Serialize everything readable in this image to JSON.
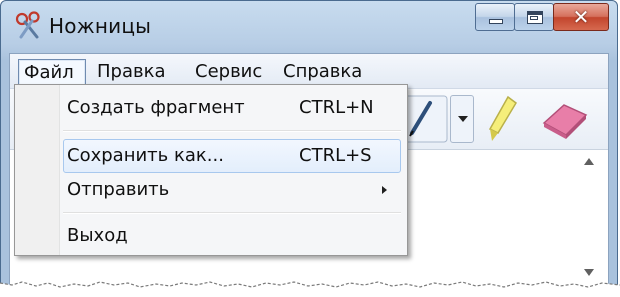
{
  "window": {
    "title": "Ножницы",
    "app_icon": "scissors-icon",
    "buttons": {
      "minimize_icon": "minimize-icon",
      "maximize_icon": "maximize-icon",
      "close_icon": "close-icon",
      "close_glyph": "✕"
    }
  },
  "menubar": {
    "items": [
      {
        "label": "Файл",
        "open": true
      },
      {
        "label": "Правка"
      },
      {
        "label": "Сервис"
      },
      {
        "label": "Справка"
      }
    ]
  },
  "toolbar": {
    "tools": [
      "pen-icon",
      "dropdown-arrow-icon",
      "highlighter-icon",
      "eraser-icon"
    ]
  },
  "file_menu": {
    "items": [
      {
        "label": "Создать фрагмент",
        "shortcut": "CTRL+N"
      },
      {
        "label": "Сохранить как...",
        "shortcut": "CTRL+S",
        "highlighted": true
      },
      {
        "label": "Отправить",
        "submenu": true
      },
      {
        "label": "Выход"
      }
    ]
  },
  "colors": {
    "title_bar": "#b7cde5",
    "close_button": "#c2452d",
    "menu_highlight_border": "#a8c8ee"
  }
}
